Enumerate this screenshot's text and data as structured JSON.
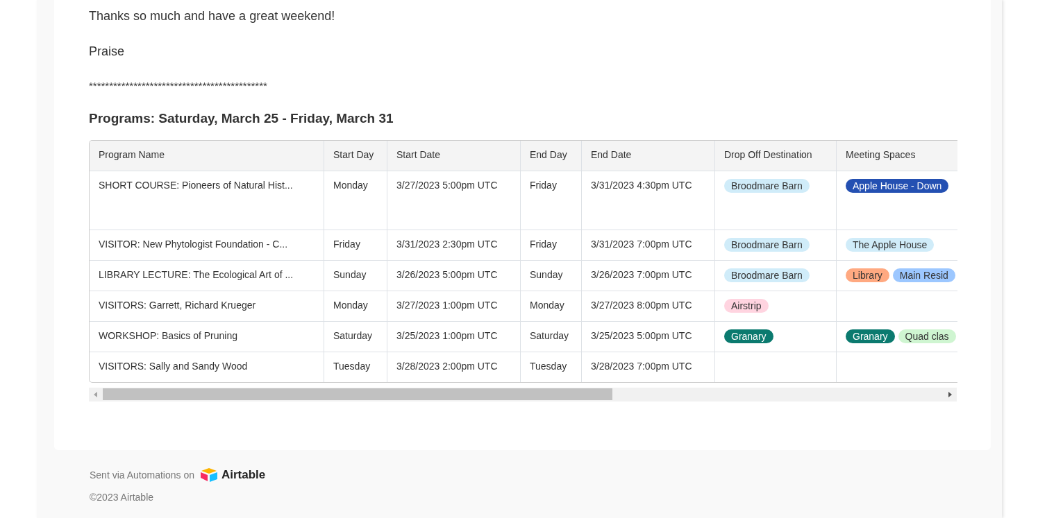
{
  "message": {
    "paragraphs": [
      "Thanks so much and have a great weekend!",
      "Praise",
      "********************************************"
    ],
    "heading": "Programs: Saturday, March 25 - Friday, March 31"
  },
  "table": {
    "columns": [
      "Program Name",
      "Start Day",
      "Start Date",
      "End Day",
      "End Date",
      "Drop Off Destination",
      "Meeting Spaces"
    ],
    "rows": [
      {
        "program_name": "SHORT COURSE: Pioneers of Natural Hist...",
        "start_day": "Monday",
        "start_date": "3/27/2023 5:00pm UTC",
        "end_day": "Friday",
        "end_date": "3/31/2023 4:30pm UTC",
        "drop_off": [
          {
            "label": "Broodmare Barn",
            "color": "#d0ecf9"
          }
        ],
        "meeting_spaces": [
          {
            "label": "Apple House - Down",
            "color": "#2450b2"
          }
        ]
      },
      {
        "program_name": "VISITOR: New Phytologist Foundation - C...",
        "start_day": "Friday",
        "start_date": "3/31/2023 2:30pm UTC",
        "end_day": "Friday",
        "end_date": "3/31/2023 7:00pm UTC",
        "drop_off": [
          {
            "label": "Broodmare Barn",
            "color": "#d0ecf9"
          }
        ],
        "meeting_spaces": [
          {
            "label": "The Apple House",
            "color": "#d0ecf9"
          }
        ]
      },
      {
        "program_name": "LIBRARY LECTURE: The Ecological Art of ...",
        "start_day": "Sunday",
        "start_date": "3/26/2023 5:00pm UTC",
        "end_day": "Sunday",
        "end_date": "3/26/2023 7:00pm UTC",
        "drop_off": [
          {
            "label": "Broodmare Barn",
            "color": "#d0ecf9"
          }
        ],
        "meeting_spaces": [
          {
            "label": "Library",
            "color": "#ffa981"
          },
          {
            "label": "Main Resid",
            "color": "#9cc7ff"
          }
        ]
      },
      {
        "program_name": "VISITORS: Garrett, Richard Krueger",
        "start_day": "Monday",
        "start_date": "3/27/2023 1:00pm UTC",
        "end_day": "Monday",
        "end_date": "3/27/2023 8:00pm UTC",
        "drop_off": [
          {
            "label": "Airstrip",
            "color": "#ffd4e0"
          }
        ],
        "meeting_spaces": []
      },
      {
        "program_name": "WORKSHOP: Basics of Pruning",
        "start_day": "Saturday",
        "start_date": "3/25/2023 1:00pm UTC",
        "end_day": "Saturday",
        "end_date": "3/25/2023 5:00pm UTC",
        "drop_off": [
          {
            "label": "Granary",
            "color": "#0b7a6f"
          }
        ],
        "meeting_spaces": [
          {
            "label": "Granary",
            "color": "#0b7a6f"
          },
          {
            "label": "Quad clas",
            "color": "#cff5d1"
          }
        ]
      },
      {
        "program_name": "VISITORS: Sally and Sandy Wood",
        "start_day": "Tuesday",
        "start_date": "3/28/2023 2:00pm UTC",
        "end_day": "Tuesday",
        "end_date": "3/28/2023 7:00pm UTC",
        "drop_off": [],
        "meeting_spaces": []
      }
    ]
  },
  "footer": {
    "sent_via": "Sent via Automations on",
    "brand": "Airtable",
    "copyright": "©2023 Airtable"
  }
}
